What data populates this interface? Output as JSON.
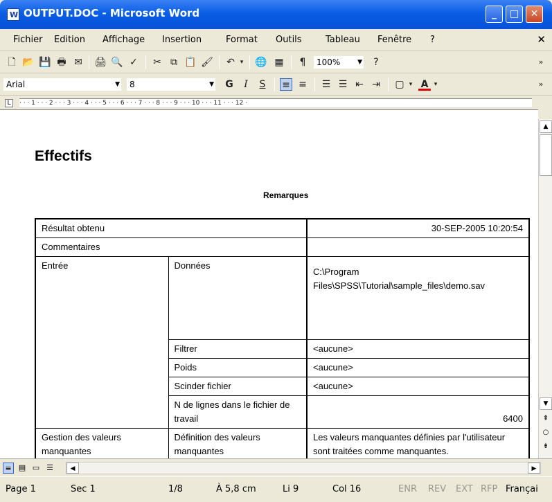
{
  "window": {
    "title": "OUTPUT.DOC - Microsoft Word",
    "icon_letter": "W"
  },
  "menu": [
    "Fichier",
    "Edition",
    "Affichage",
    "Insertion",
    "Format",
    "Outils",
    "Tableau",
    "Fenêtre",
    "?"
  ],
  "toolbar": {
    "zoom": "100%",
    "font": "Arial",
    "size": "8"
  },
  "ruler_text": "· · · 1 · · · 2 · · · 3 · · · 4 · · · 5 · · · 6 · · · 7 · · · 8 · · · 9 · · · 10 · · · 11 · · · 12 ·",
  "doc": {
    "heading": "Effectifs",
    "remarques": "Remarques",
    "rows": {
      "resultat": {
        "label": "Résultat obtenu",
        "value": "30-SEP-2005 10:20:54"
      },
      "commentaires": {
        "label": "Commentaires",
        "value": ""
      },
      "entree": {
        "label": "Entrée",
        "sub": "Données",
        "value": "C:\\Program Files\\SPSS\\Tutorial\\sample_files\\demo.sav"
      },
      "filtrer": {
        "sub": "Filtrer",
        "value": "<aucune>"
      },
      "poids": {
        "sub": "Poids",
        "value": "<aucune>"
      },
      "scinder": {
        "sub": "Scinder fichier",
        "value": "<aucune>"
      },
      "nlignes": {
        "sub": "N de lignes dans le fichier de travail",
        "value": "6400"
      },
      "gestion": {
        "label": "Gestion des valeurs manquantes",
        "sub": "Définition des valeurs manquantes",
        "value": "Les valeurs manquantes définies par l'utilisateur sont traitées comme manquantes."
      }
    }
  },
  "status": {
    "page": "Page 1",
    "sec": "Sec 1",
    "pages": "1/8",
    "pos": "À 5,8 cm",
    "line": "Li 9",
    "col": "Col 16",
    "enr": "ENR",
    "rev": "REV",
    "ext": "EXT",
    "rfp": "RFP",
    "lang": "Françai"
  }
}
